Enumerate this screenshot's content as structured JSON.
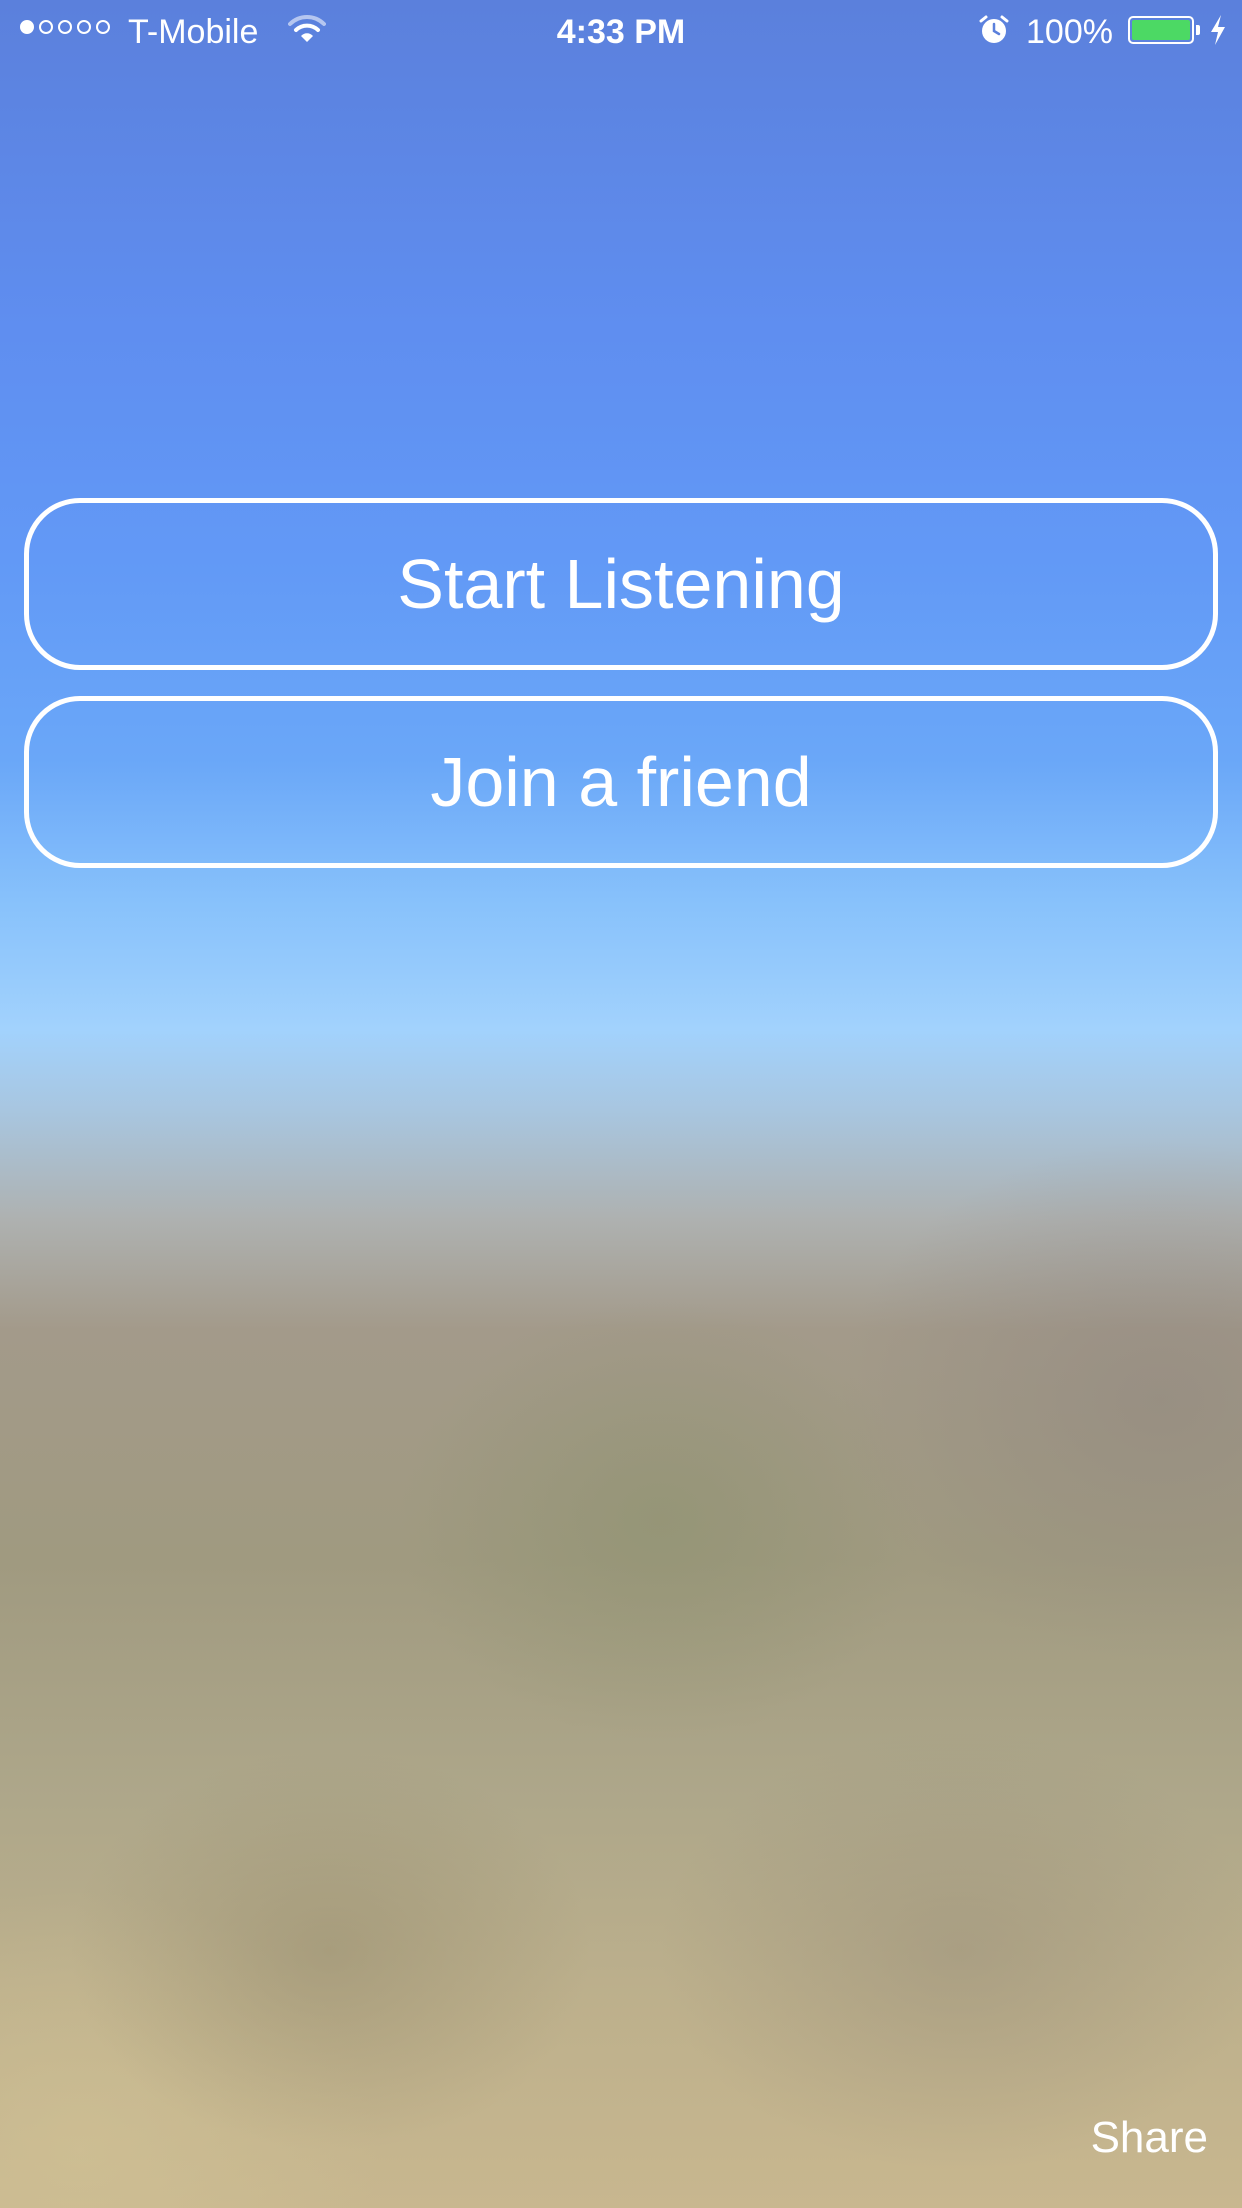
{
  "status_bar": {
    "signal_strength": "1 of 5",
    "carrier": "T-Mobile",
    "wifi_icon": "wifi-icon",
    "time": "4:33 PM",
    "alarm_icon": "alarm-clock-icon",
    "battery_percent": "100%",
    "battery_level": 1.0,
    "battery_color": "#4cd964",
    "charging_icon": "lightning-bolt-icon"
  },
  "main": {
    "start_listening_label": "Start Listening",
    "join_friend_label": "Join a friend"
  },
  "footer": {
    "share_label": "Share"
  },
  "colors": {
    "sky_top": "#5b80dc",
    "sky_bottom": "#a2d2fd",
    "ground": "#a09a80"
  }
}
